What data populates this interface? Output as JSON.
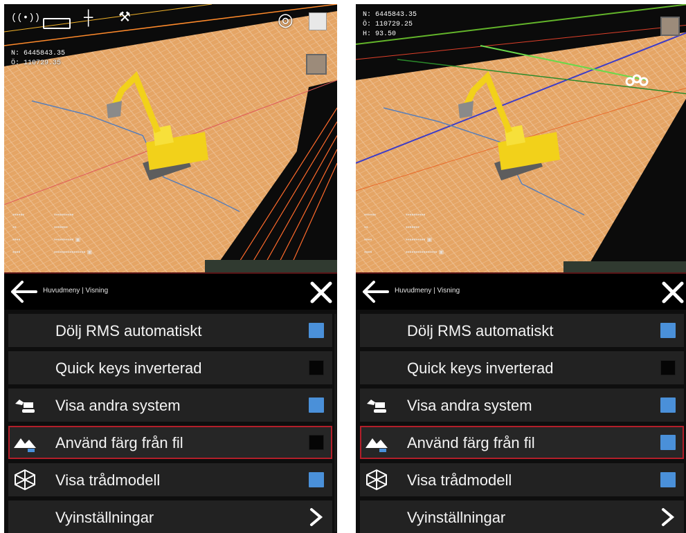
{
  "panels": [
    {
      "id": "left",
      "coords": {
        "n": "N: 6445843.35",
        "o": "Ö: 110729.35",
        "h": ""
      },
      "menu": {
        "breadcrumb": "Huvudmeny | Visning",
        "items": [
          {
            "label": "Dölj RMS automatiskt",
            "icon": "",
            "control": "checkbox",
            "checked": true
          },
          {
            "label": "Quick keys  inverterad",
            "icon": "",
            "control": "checkbox",
            "checked": false
          },
          {
            "label": "Visa andra system",
            "icon": "excavator-icon",
            "control": "checkbox",
            "checked": true
          },
          {
            "label": "Använd färg från fil",
            "icon": "terrain-icon",
            "control": "checkbox",
            "checked": false,
            "highlighted": true
          },
          {
            "label": "Visa trådmodell",
            "icon": "wireframe-cube-icon",
            "control": "checkbox",
            "checked": true
          },
          {
            "label": "Vyinställningar",
            "icon": "",
            "control": "chevron"
          }
        ]
      }
    },
    {
      "id": "right",
      "coords": {
        "n": "N: 6445843.35",
        "o": "Ö: 110729.25",
        "h": "H: 93.50"
      },
      "menu": {
        "breadcrumb": "Huvudmeny | Visning",
        "items": [
          {
            "label": "Dölj RMS automatiskt",
            "icon": "",
            "control": "checkbox",
            "checked": true
          },
          {
            "label": "Quick keys  inverterad",
            "icon": "",
            "control": "checkbox",
            "checked": false
          },
          {
            "label": "Visa andra system",
            "icon": "excavator-icon",
            "control": "checkbox",
            "checked": true
          },
          {
            "label": "Använd färg från fil",
            "icon": "terrain-icon",
            "control": "checkbox",
            "checked": true,
            "highlighted": true
          },
          {
            "label": "Visa trådmodell",
            "icon": "wireframe-cube-icon",
            "control": "checkbox",
            "checked": true
          },
          {
            "label": "Vyinställningar",
            "icon": "",
            "control": "chevron"
          }
        ]
      }
    }
  ],
  "colors": {
    "checkbox_on": "#4a90d9",
    "highlight_outline": "#b31f2a",
    "terrain": "#e8a968"
  }
}
